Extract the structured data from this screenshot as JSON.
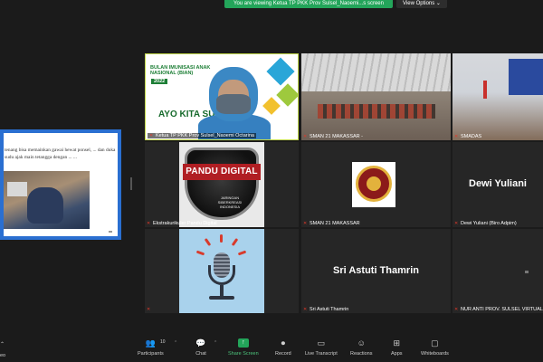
{
  "banner": {
    "viewing_text": "You are viewing Ketua TP PKK Prov Sulsel_Naoemi...s screen",
    "view_options": "View Options"
  },
  "shared_screen": {
    "text": "tenang bisa memainkan gawai hewat ponsel, ... dan duka sudu ajak main tetangga dengan ... ..."
  },
  "tiles": [
    {
      "id": "ketua",
      "label": "Ketua TP PKK Prov Sulsel_Naoemi Octarina",
      "poster_title": "BULAN IMUNISASI ANAK NASIONAL (BIAN)",
      "poster_year": "2022",
      "poster_slogan": "AYO KITA SUKSESK...",
      "muted": true
    },
    {
      "id": "sman21a",
      "label": "SMAN 21 MAKASSAR -",
      "muted": true
    },
    {
      "id": "smada",
      "label": "SMADAS",
      "muted": true
    },
    {
      "id": "ekstra",
      "label": "Ekstrakurikuler Pandu Digital",
      "badge_title": "PANDU DIGITAL",
      "badge_sub": "JARINGAN SIBERKREASI INDONESIA",
      "muted": true
    },
    {
      "id": "sman21b",
      "label": "SMAN 21 MAKASSAR",
      "muted": true
    },
    {
      "id": "dewi",
      "label": "Dewi Yuliani (Biro Adpim)",
      "name": "Dewi Yuliani",
      "muted": true
    },
    {
      "id": "podcast",
      "label": "",
      "muted": true
    },
    {
      "id": "sri",
      "label": "Sri Astuti Thamrin",
      "name": "Sri Astuti Thamrin",
      "muted": true
    },
    {
      "id": "nur",
      "label": "NUR ANTI PROV. SULSEL VIRTUAL",
      "muted": true
    }
  ],
  "toolbar": {
    "left_partial": "eo",
    "participants_label": "Participants",
    "participants_count": "10",
    "chat_label": "Chat",
    "share_label": "Share Screen",
    "record_label": "Record",
    "transcript_label": "Live Transcript",
    "reactions_label": "Reactions",
    "apps_label": "Apps",
    "whiteboards_label": "Whiteboards"
  },
  "icons": {
    "participants": "people-icon",
    "chat": "chat-icon",
    "share": "share-screen-icon",
    "record": "record-icon",
    "transcript": "cc-icon",
    "reactions": "smiley-icon",
    "apps": "apps-icon",
    "whiteboards": "whiteboard-icon",
    "muted": "mic-muted-icon"
  },
  "colors": {
    "share_green": "#23a55a",
    "muted_red": "#e0392b",
    "share_border": "#2a6fd1"
  }
}
